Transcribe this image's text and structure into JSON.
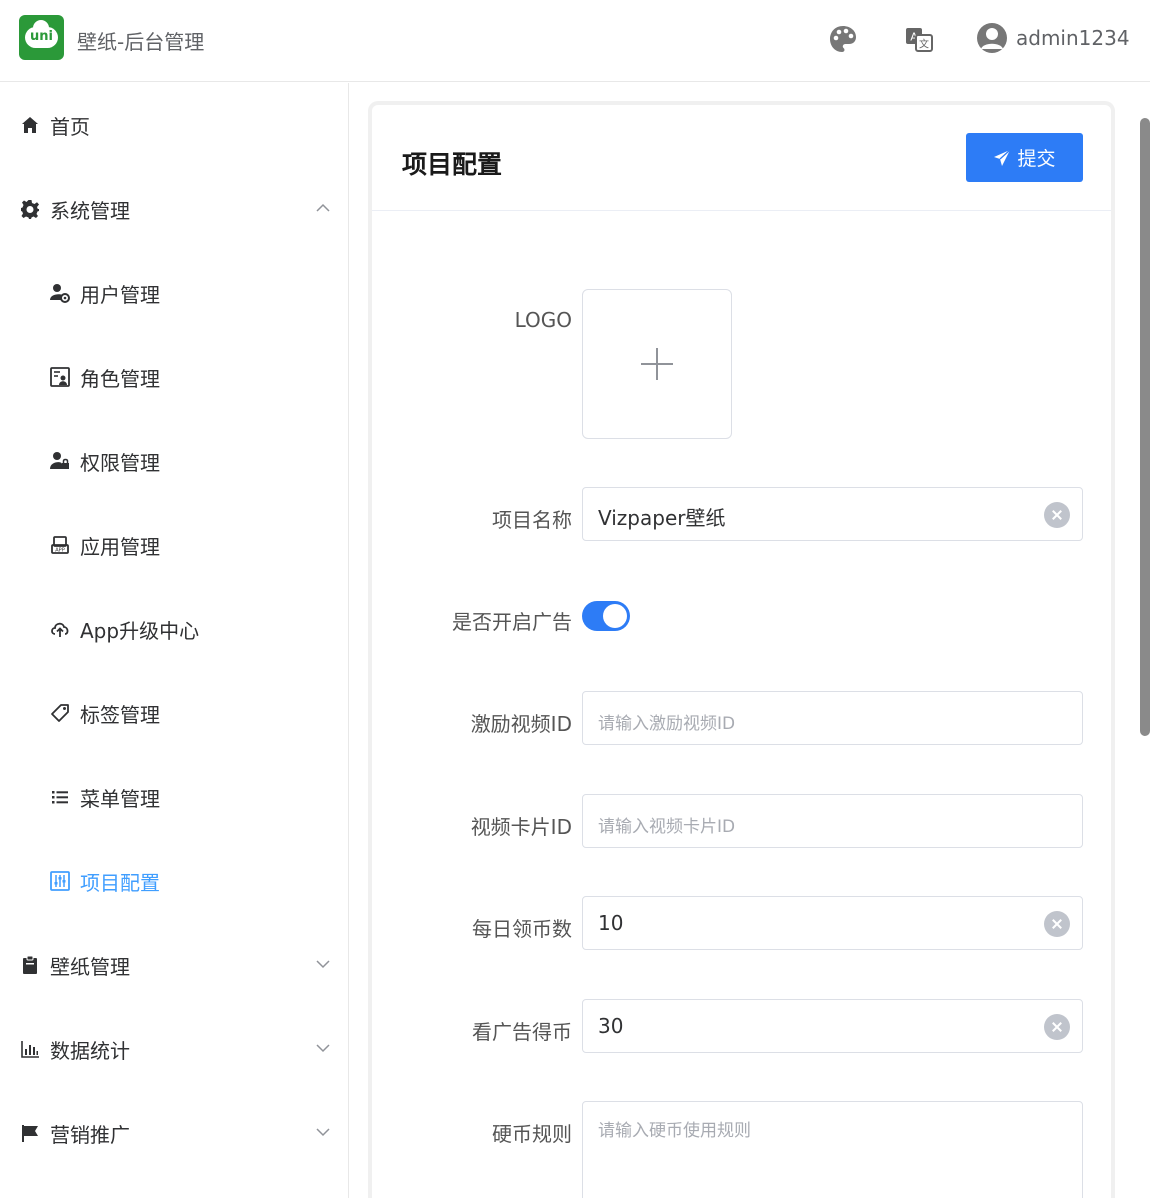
{
  "header": {
    "logo_text": "uni",
    "title": "壁纸-后台管理",
    "username": "admin1234"
  },
  "sidebar": {
    "items": [
      {
        "label": "首页",
        "icon": "home-icon"
      },
      {
        "label": "系统管理",
        "icon": "gear-icon",
        "expanded": true
      },
      {
        "label": "用户管理",
        "icon": "user-gear-icon"
      },
      {
        "label": "角色管理",
        "icon": "role-card-icon"
      },
      {
        "label": "权限管理",
        "icon": "user-lock-icon"
      },
      {
        "label": "应用管理",
        "icon": "app-icon"
      },
      {
        "label": "App升级中心",
        "icon": "cloud-upload-icon"
      },
      {
        "label": "标签管理",
        "icon": "tag-icon"
      },
      {
        "label": "菜单管理",
        "icon": "list-icon"
      },
      {
        "label": "项目配置",
        "icon": "settings-panel-icon",
        "active": true
      },
      {
        "label": "壁纸管理",
        "icon": "clipboard-icon",
        "expanded": false
      },
      {
        "label": "数据统计",
        "icon": "bar-chart-icon",
        "expanded": false
      },
      {
        "label": "营销推广",
        "icon": "flag-icon",
        "expanded": false
      }
    ]
  },
  "card": {
    "title": "项目配置",
    "submit_label": "提交"
  },
  "form": {
    "logo_label": "LOGO",
    "project_name_label": "项目名称",
    "project_name_value": "Vizpaper壁纸",
    "ad_enabled_label": "是否开启广告",
    "ad_enabled": true,
    "reward_video_label": "激励视频ID",
    "reward_video_placeholder": "请输入激励视频ID",
    "video_card_label": "视频卡片ID",
    "video_card_placeholder": "请输入视频卡片ID",
    "daily_coins_label": "每日领币数",
    "daily_coins_value": "10",
    "ad_coins_label": "看广告得币",
    "ad_coins_value": "30",
    "coin_rules_label": "硬币规则",
    "coin_rules_placeholder": "请输入硬币使用规则"
  },
  "colors": {
    "primary": "#2d7cf6",
    "brand_green": "#2b9939"
  }
}
